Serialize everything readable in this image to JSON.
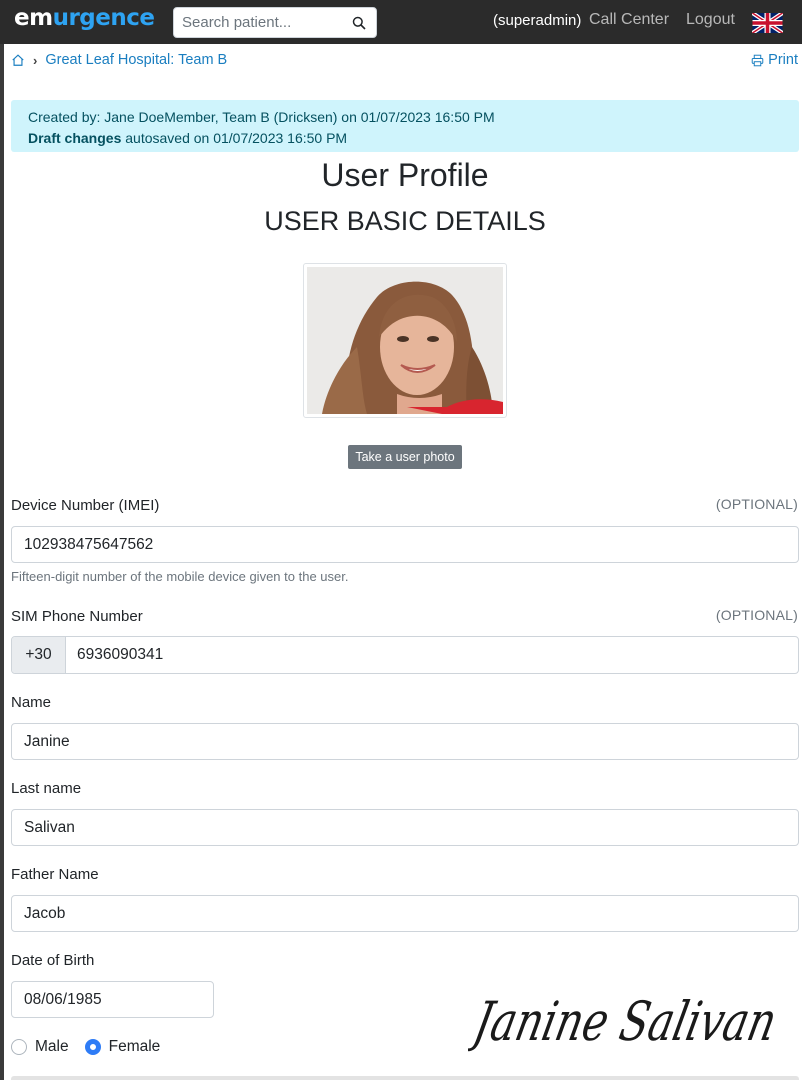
{
  "app": {
    "brand_part1": "em",
    "brand_part2": "urgence",
    "search_placeholder": "Search patient...",
    "user": "(superadmin)",
    "call_center": "Call Center",
    "logout": "Logout"
  },
  "breadcrumb": {
    "item": "Great Leaf Hospital: Team B",
    "print": "Print"
  },
  "alert": {
    "line1": "Created by: Jane DoeMember, Team B (Dricksen) on 01/07/2023 16:50 PM",
    "draft_label": "Draft changes",
    "draft_rest": " autosaved on 01/07/2023 16:50 PM"
  },
  "page": {
    "title": "User Profile",
    "subtitle": "USER BASIC DETAILS",
    "photo_button": "Take a user photo"
  },
  "form": {
    "imei": {
      "label": "Device Number (IMEI)",
      "optional": "(OPTIONAL)",
      "value": "102938475647562",
      "help": "Fifteen-digit number of the mobile device given to the user."
    },
    "sim": {
      "label": "SIM Phone Number",
      "optional": "(OPTIONAL)",
      "prefix": "+30",
      "value": "6936090341"
    },
    "name": {
      "label": "Name",
      "value": "Janine"
    },
    "last_name": {
      "label": "Last name",
      "value": "Salivan"
    },
    "father_name": {
      "label": "Father Name",
      "value": "Jacob"
    },
    "dob": {
      "label": "Date of Birth",
      "value": "08/06/1985"
    },
    "gender": {
      "male": "Male",
      "female": "Female",
      "selected": "Female"
    }
  },
  "signature": "Janine Salivan",
  "colors": {
    "navbar": "#2b2b2b",
    "brand_accent": "#2ea3f2",
    "link": "#1a7ec0",
    "alert_bg": "#cff4fc",
    "radio_checked": "#2e7cf6"
  },
  "icons": [
    "home-icon",
    "chevron-right-icon",
    "printer-icon",
    "search-icon",
    "uk-flag-icon"
  ]
}
